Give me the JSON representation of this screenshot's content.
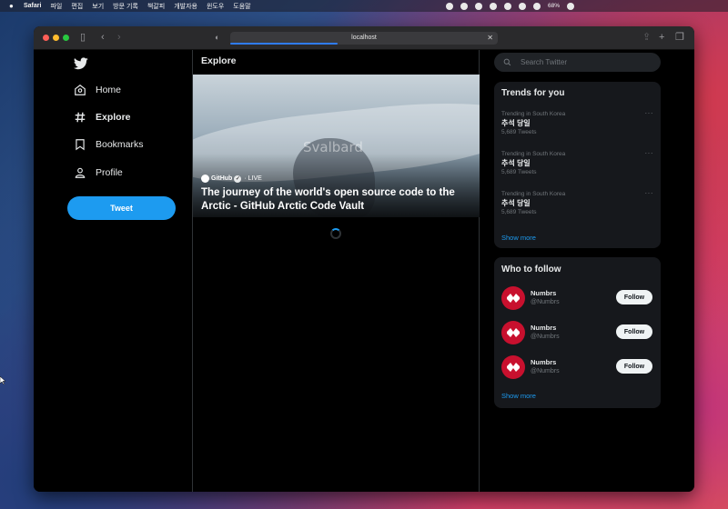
{
  "menubar": {
    "app": "Safari",
    "items": [
      "파일",
      "편집",
      "보기",
      "방문 기록",
      "책갈피",
      "개발자용",
      "윈도우",
      "도움말"
    ],
    "battery": "68%"
  },
  "browser": {
    "url": "localhost"
  },
  "nav": {
    "items": [
      {
        "label": "Home"
      },
      {
        "label": "Explore"
      },
      {
        "label": "Bookmarks"
      },
      {
        "label": "Profile"
      }
    ],
    "tweet_button": "Tweet"
  },
  "main": {
    "header": "Explore",
    "hero": {
      "source": "GitHub",
      "verified_mark": "✓",
      "status": "· LIVE",
      "title": "The journey of the world's open source code to the Arctic - GitHub Arctic Code Vault",
      "watermark": "Svalbard"
    }
  },
  "sidebar": {
    "search_placeholder": "Search Twitter",
    "trends": {
      "title": "Trends for you",
      "items": [
        {
          "context": "Trending in South Korea",
          "name": "추석 당일",
          "count": "5,689 Tweets"
        },
        {
          "context": "Trending in South Korea",
          "name": "추석 당일",
          "count": "5,689 Tweets"
        },
        {
          "context": "Trending in South Korea",
          "name": "추석 당일",
          "count": "5,689 Tweets"
        }
      ],
      "more_glyph": "···",
      "show_more": "Show more"
    },
    "who_to_follow": {
      "title": "Who to follow",
      "items": [
        {
          "name": "Numbrs",
          "handle": "@Numbrs",
          "button": "Follow"
        },
        {
          "name": "Numbrs",
          "handle": "@Numbrs",
          "button": "Follow"
        },
        {
          "name": "Numbrs",
          "handle": "@Numbrs",
          "button": "Follow"
        }
      ],
      "show_more": "Show more"
    }
  },
  "colors": {
    "accent": "#1d9bf0",
    "background": "#000000",
    "card": "#16181c",
    "avatar_red": "#c8102e"
  }
}
